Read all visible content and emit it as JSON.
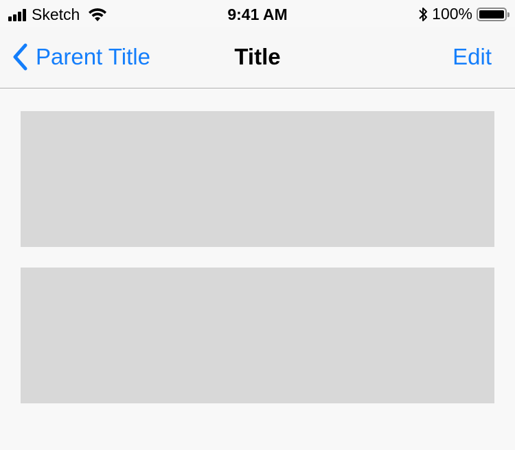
{
  "status_bar": {
    "carrier": "Sketch",
    "time": "9:41 AM",
    "battery_percent": "100%",
    "battery_level": 1.0,
    "icons": [
      "signal-icon",
      "wifi-icon",
      "bluetooth-icon",
      "battery-icon"
    ]
  },
  "nav_bar": {
    "back_label": "Parent Title",
    "title": "Title",
    "edit_label": "Edit",
    "accent_color": "#147efb"
  },
  "content": {
    "placeholder_color": "#d8d8d8",
    "placeholders": [
      "content-placeholder-1",
      "content-placeholder-2"
    ]
  }
}
